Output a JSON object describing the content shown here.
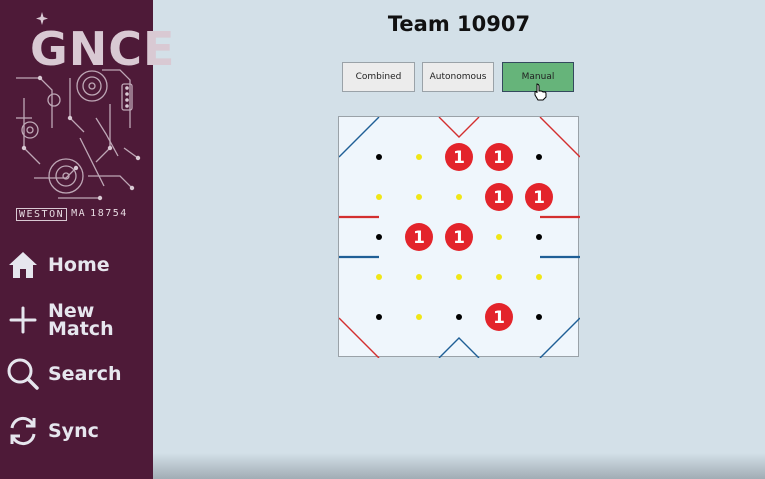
{
  "sidebar": {
    "logo": {
      "title": "GNCE",
      "footer_left": "WESTON",
      "footer_mid": "MA",
      "footer_right": "18754"
    },
    "items": [
      {
        "label": "Home",
        "icon": "home-icon"
      },
      {
        "label": "New\nMatch",
        "icon": "plus-icon"
      },
      {
        "label": "Search",
        "icon": "search-icon"
      },
      {
        "label": "Sync",
        "icon": "sync-icon"
      }
    ]
  },
  "header": {
    "title": "Team 10907"
  },
  "tabs": {
    "combined": "Combined",
    "autonomous": "Autonomous",
    "manual": "Manual",
    "active": "manual"
  },
  "field": {
    "grid": [
      [
        "dot-black",
        "dot-yellow",
        "1",
        "1",
        "dot-black"
      ],
      [
        "dot-yellow",
        "dot-yellow",
        "dot-yellow",
        "1",
        "1"
      ],
      [
        "dot-black",
        "1",
        "1",
        "dot-yellow",
        "dot-black"
      ],
      [
        "dot-yellow",
        "dot-yellow",
        "dot-yellow",
        "dot-yellow",
        "dot-yellow"
      ],
      [
        "dot-black",
        "dot-yellow",
        "dot-black",
        "1",
        "dot-black"
      ]
    ],
    "colors": {
      "red": "#d32f2f",
      "blue": "#1f5f96",
      "marker": "#e3242b",
      "yellow": "#f0e616",
      "black": "#000000"
    }
  }
}
